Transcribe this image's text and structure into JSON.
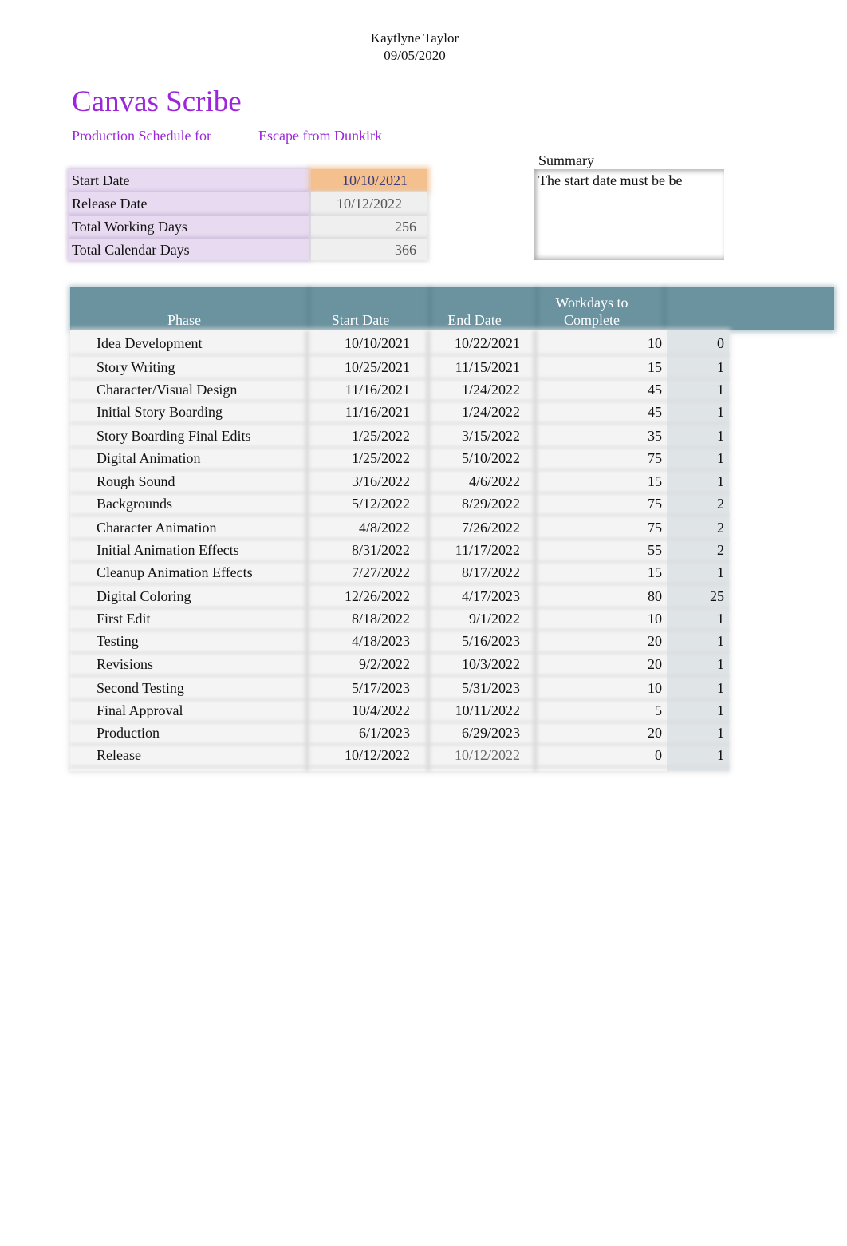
{
  "header": {
    "author": "Kaytlyne Taylor",
    "date": "09/05/2020"
  },
  "title": "Canvas Scribe",
  "subtitle": {
    "label": "Production Schedule for",
    "project": "Escape from Dunkirk"
  },
  "info": {
    "start_date_label": "Start Date",
    "start_date_value": "10/10/2021",
    "release_date_label": "Release Date",
    "release_date_value": "10/12/2022",
    "total_working_days_label": "Total Working Days",
    "total_working_days_value": "256",
    "total_calendar_days_label": "Total Calendar Days",
    "total_calendar_days_value": "366"
  },
  "summary": {
    "title": "Summary",
    "text": "The start date must be be"
  },
  "colors": {
    "brand_purple": "#9b27d9",
    "header_teal": "#6a929f",
    "start_date_highlight": "#f4c18e",
    "label_lavender": "#e8dbf1"
  },
  "table": {
    "headers": {
      "phase": "Phase",
      "start": "Start Date",
      "end": "End Date",
      "work_line1": "Workdays to",
      "work_line2": "Complete",
      "extra": ""
    },
    "rows": [
      {
        "phase": "Idea Development",
        "start": "10/10/2021",
        "end": "10/22/2021",
        "workdays": "10",
        "extra": "0"
      },
      {
        "phase": "Story Writing",
        "start": "10/25/2021",
        "end": "11/15/2021",
        "workdays": "15",
        "extra": "1"
      },
      {
        "phase": "Character/Visual Design",
        "start": "11/16/2021",
        "end": "1/24/2022",
        "workdays": "45",
        "extra": "1"
      },
      {
        "phase": "Initial Story Boarding",
        "start": "11/16/2021",
        "end": "1/24/2022",
        "workdays": "45",
        "extra": "1"
      },
      {
        "phase": "Story Boarding Final Edits",
        "start": "1/25/2022",
        "end": "3/15/2022",
        "workdays": "35",
        "extra": "1"
      },
      {
        "phase": "Digital Animation",
        "start": "1/25/2022",
        "end": "5/10/2022",
        "workdays": "75",
        "extra": "1"
      },
      {
        "phase": "Rough Sound",
        "start": "3/16/2022",
        "end": "4/6/2022",
        "workdays": "15",
        "extra": "1"
      },
      {
        "phase": "Backgrounds",
        "start": "5/12/2022",
        "end": "8/29/2022",
        "workdays": "75",
        "extra": "2"
      },
      {
        "phase": "Character Animation",
        "start": "4/8/2022",
        "end": "7/26/2022",
        "workdays": "75",
        "extra": "2"
      },
      {
        "phase": "Initial Animation Effects",
        "start": "8/31/2022",
        "end": "11/17/2022",
        "workdays": "55",
        "extra": "2"
      },
      {
        "phase": "Cleanup Animation Effects",
        "start": "7/27/2022",
        "end": "8/17/2022",
        "workdays": "15",
        "extra": "1"
      },
      {
        "phase": "Digital Coloring",
        "start": "12/26/2022",
        "end": "4/17/2023",
        "workdays": "80",
        "extra": "25"
      },
      {
        "phase": "First Edit",
        "start": "8/18/2022",
        "end": "9/1/2022",
        "workdays": "10",
        "extra": "1"
      },
      {
        "phase": "Testing",
        "start": "4/18/2023",
        "end": "5/16/2023",
        "workdays": "20",
        "extra": "1"
      },
      {
        "phase": "Revisions",
        "start": "9/2/2022",
        "end": "10/3/2022",
        "workdays": "20",
        "extra": "1"
      },
      {
        "phase": "Second Testing",
        "start": "5/17/2023",
        "end": "5/31/2023",
        "workdays": "10",
        "extra": "1"
      },
      {
        "phase": "Final Approval",
        "start": "10/4/2022",
        "end": "10/11/2022",
        "workdays": "5",
        "extra": "1"
      },
      {
        "phase": "Production",
        "start": "6/1/2023",
        "end": "6/29/2023",
        "workdays": "20",
        "extra": "1"
      },
      {
        "phase": "Release",
        "start": "10/12/2022",
        "end": "10/12/2022",
        "workdays": "0",
        "extra": "1"
      }
    ]
  }
}
